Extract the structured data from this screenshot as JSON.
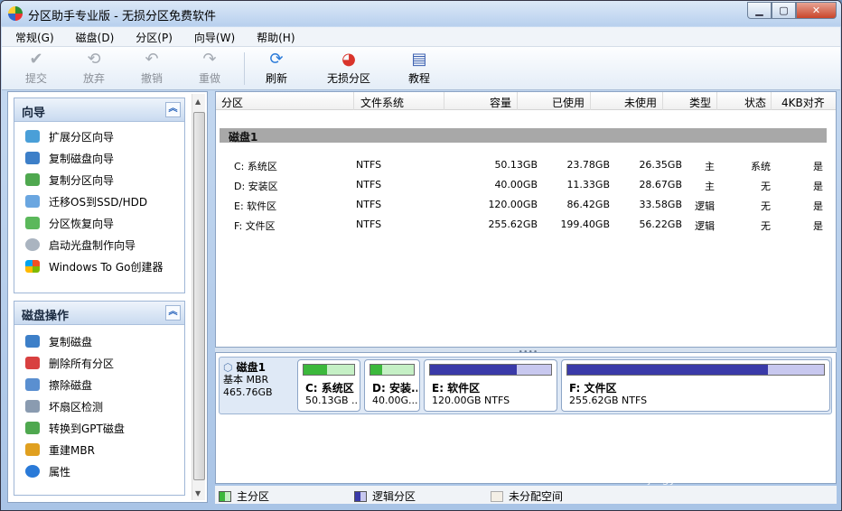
{
  "window": {
    "title": "分区助手专业版 - 无损分区免费软件"
  },
  "menu": [
    "常规(G)",
    "磁盘(D)",
    "分区(P)",
    "向导(W)",
    "帮助(H)"
  ],
  "toolbar": {
    "commit": "提交",
    "discard": "放弃",
    "undo": "撤销",
    "redo": "重做",
    "refresh": "刷新",
    "lossless": "无损分区",
    "tutorial": "教程"
  },
  "wizard_panel": {
    "title": "向导",
    "items": [
      "扩展分区向导",
      "复制磁盘向导",
      "复制分区向导",
      "迁移OS到SSD/HDD",
      "分区恢复向导",
      "启动光盘制作向导",
      "Windows To Go创建器"
    ]
  },
  "disk_panel": {
    "title": "磁盘操作",
    "items": [
      "复制磁盘",
      "删除所有分区",
      "擦除磁盘",
      "坏扇区检测",
      "转换到GPT磁盘",
      "重建MBR",
      "属性"
    ]
  },
  "table": {
    "columns": [
      "分区",
      "文件系统",
      "容量",
      "已使用",
      "未使用",
      "类型",
      "状态",
      "4KB对齐"
    ],
    "disk_label": "磁盘1",
    "rows": [
      {
        "name": "C: 系统区",
        "fs": "NTFS",
        "cap": "50.13GB",
        "used": "23.78GB",
        "free": "26.35GB",
        "type": "主",
        "status": "系统",
        "align": "是"
      },
      {
        "name": "D: 安装区",
        "fs": "NTFS",
        "cap": "40.00GB",
        "used": "11.33GB",
        "free": "28.67GB",
        "type": "主",
        "status": "无",
        "align": "是"
      },
      {
        "name": "E: 软件区",
        "fs": "NTFS",
        "cap": "120.00GB",
        "used": "86.42GB",
        "free": "33.58GB",
        "type": "逻辑",
        "status": "无",
        "align": "是"
      },
      {
        "name": "F: 文件区",
        "fs": "NTFS",
        "cap": "255.62GB",
        "used": "199.40GB",
        "free": "56.22GB",
        "type": "逻辑",
        "status": "无",
        "align": "是"
      }
    ]
  },
  "diskmap": {
    "disk_name": "磁盘1",
    "disk_type": "基本 MBR",
    "disk_size": "465.76GB",
    "parts": [
      {
        "name": "C: 系统区",
        "sub": "50.13GB ...",
        "used_frac": 0.47,
        "kind": "primary"
      },
      {
        "name": "D: 安装...",
        "sub": "40.00G...",
        "used_frac": 0.28,
        "kind": "primary"
      },
      {
        "name": "E: 软件区",
        "sub": "120.00GB NTFS",
        "used_frac": 0.72,
        "kind": "logical"
      },
      {
        "name": "F: 文件区",
        "sub": "255.62GB NTFS",
        "used_frac": 0.78,
        "kind": "logical"
      }
    ]
  },
  "legend": {
    "primary": "主分区",
    "logical": "逻辑分区",
    "unalloc": "未分配空间"
  },
  "colors": {
    "primary": "#3cb83c",
    "logical": "#3a3aa8",
    "primary_free": "#c5f0c5",
    "logical_free": "#c8c8ef"
  },
  "watermark": {
    "logo": "Baidu经验",
    "url": "jingyan.baidu.com"
  }
}
